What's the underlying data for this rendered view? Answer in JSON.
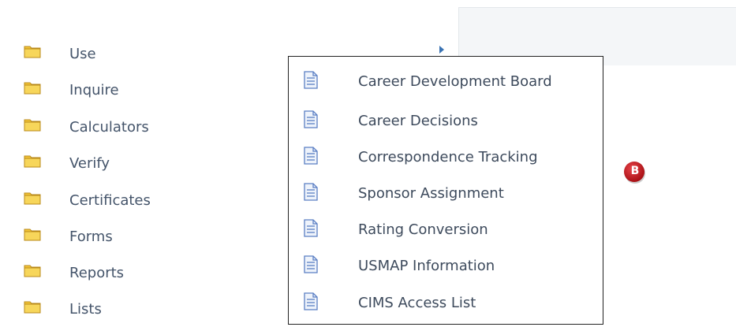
{
  "sidebar": {
    "items": [
      {
        "label": "Use",
        "icon": "folder-icon"
      },
      {
        "label": "Inquire",
        "icon": "folder-icon"
      },
      {
        "label": "Calculators",
        "icon": "folder-icon"
      },
      {
        "label": "Verify",
        "icon": "folder-icon"
      },
      {
        "label": "Certificates",
        "icon": "folder-icon"
      },
      {
        "label": "Forms",
        "icon": "folder-icon"
      },
      {
        "label": "Reports",
        "icon": "folder-icon"
      },
      {
        "label": "Lists",
        "icon": "folder-icon"
      }
    ]
  },
  "submenu": {
    "items": [
      {
        "label": "Career Development Board",
        "icon": "document-icon"
      },
      {
        "label": "Career Decisions",
        "icon": "document-icon"
      },
      {
        "label": "Correspondence Tracking",
        "icon": "document-icon"
      },
      {
        "label": "Sponsor Assignment",
        "icon": "document-icon"
      },
      {
        "label": "Rating Conversion",
        "icon": "document-icon"
      },
      {
        "label": "USMAP Information",
        "icon": "document-icon"
      },
      {
        "label": "CIMS Access List",
        "icon": "document-icon"
      }
    ]
  },
  "badge": {
    "letter": "B",
    "color": "#c8171d"
  },
  "colors": {
    "folder": "#f3c537",
    "document": "#5b7fc4",
    "accent": "#3a73b3"
  }
}
